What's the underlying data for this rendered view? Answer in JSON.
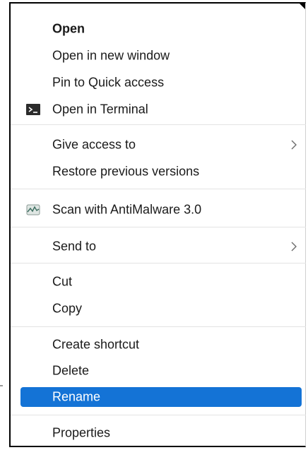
{
  "context_menu": {
    "items": [
      {
        "label": "Open",
        "bold": true
      },
      {
        "label": "Open in new window"
      },
      {
        "label": "Pin to Quick access"
      },
      {
        "label": "Open in Terminal",
        "icon": "terminal-icon"
      },
      {
        "label": "Give access to",
        "submenu": true
      },
      {
        "label": "Restore previous versions"
      },
      {
        "label": "Scan with AntiMalware 3.0",
        "icon": "antimalware-icon"
      },
      {
        "label": "Send to",
        "submenu": true
      },
      {
        "label": "Cut"
      },
      {
        "label": "Copy"
      },
      {
        "label": "Create shortcut"
      },
      {
        "label": "Delete"
      },
      {
        "label": "Rename",
        "selected": true
      },
      {
        "label": "Properties"
      }
    ],
    "selection_color": "#1473d6",
    "text_color": "#1a1a1a"
  }
}
